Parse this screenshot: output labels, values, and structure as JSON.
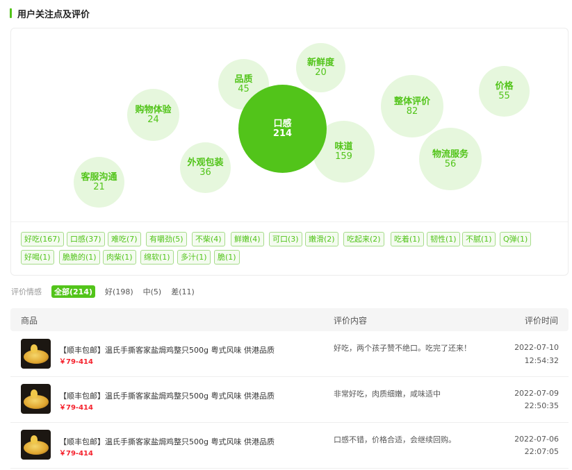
{
  "section": {
    "title": "用户关注点及评价"
  },
  "bubbles": [
    {
      "label": "口感",
      "count": "214"
    },
    {
      "label": "新鲜度",
      "count": "20"
    },
    {
      "label": "品质",
      "count": "45"
    },
    {
      "label": "购物体验",
      "count": "24"
    },
    {
      "label": "外观包装",
      "count": "36"
    },
    {
      "label": "客服沟通",
      "count": "21"
    },
    {
      "label": "味道",
      "count": "159"
    },
    {
      "label": "整体评价",
      "count": "82"
    },
    {
      "label": "物流服务",
      "count": "56"
    },
    {
      "label": "价格",
      "count": "55"
    }
  ],
  "tags": [
    "好吃(167)",
    "口感(37)",
    "难吃(7)",
    "有嚼劲(5)",
    "不柴(4)",
    "鲜嫩(4)",
    "可口(3)",
    "嫩滑(2)",
    "吃起来(2)",
    "吃着(1)",
    "韧性(1)",
    "不腻(1)",
    "Q弹(1)",
    "好喝(1)",
    "脆脆的(1)",
    "肉柴(1)",
    "绵软(1)",
    "多汁(1)",
    "脆(1)"
  ],
  "filter": {
    "label": "评价情感",
    "options": [
      "全部(214)",
      "好(198)",
      "中(5)",
      "差(11)"
    ],
    "active_index": 0
  },
  "table": {
    "headers": {
      "product": "商品",
      "content": "评价内容",
      "time": "评价时间"
    },
    "rows": [
      {
        "product": "【顺丰包邮】温氏手撕客家盐焗鸡整只500g 粤式风味 供港品质",
        "price": "￥79-414",
        "review": "好吃，两个孩子赞不绝口。吃完了还来！",
        "date": "2022-07-10",
        "time": "12:54:32"
      },
      {
        "product": "【顺丰包邮】温氏手撕客家盐焗鸡整只500g 粤式风味 供港品质",
        "price": "￥79-414",
        "review": "非常好吃，肉质细嫩，咸味适中",
        "date": "2022-07-09",
        "time": "22:50:35"
      },
      {
        "product": "【顺丰包邮】温氏手撕客家盐焗鸡整只500g 粤式风味 供港品质",
        "price": "￥79-414",
        "review": "口感不错，价格合适，会继续回购。",
        "date": "2022-07-06",
        "time": "22:07:05"
      }
    ]
  },
  "colors": {
    "accent": "#52c41a",
    "bubble_bg": "#e6f7dd",
    "price": "#f5222d"
  },
  "icons": {
    "product_thumb": "food-thumbnail-icon"
  }
}
